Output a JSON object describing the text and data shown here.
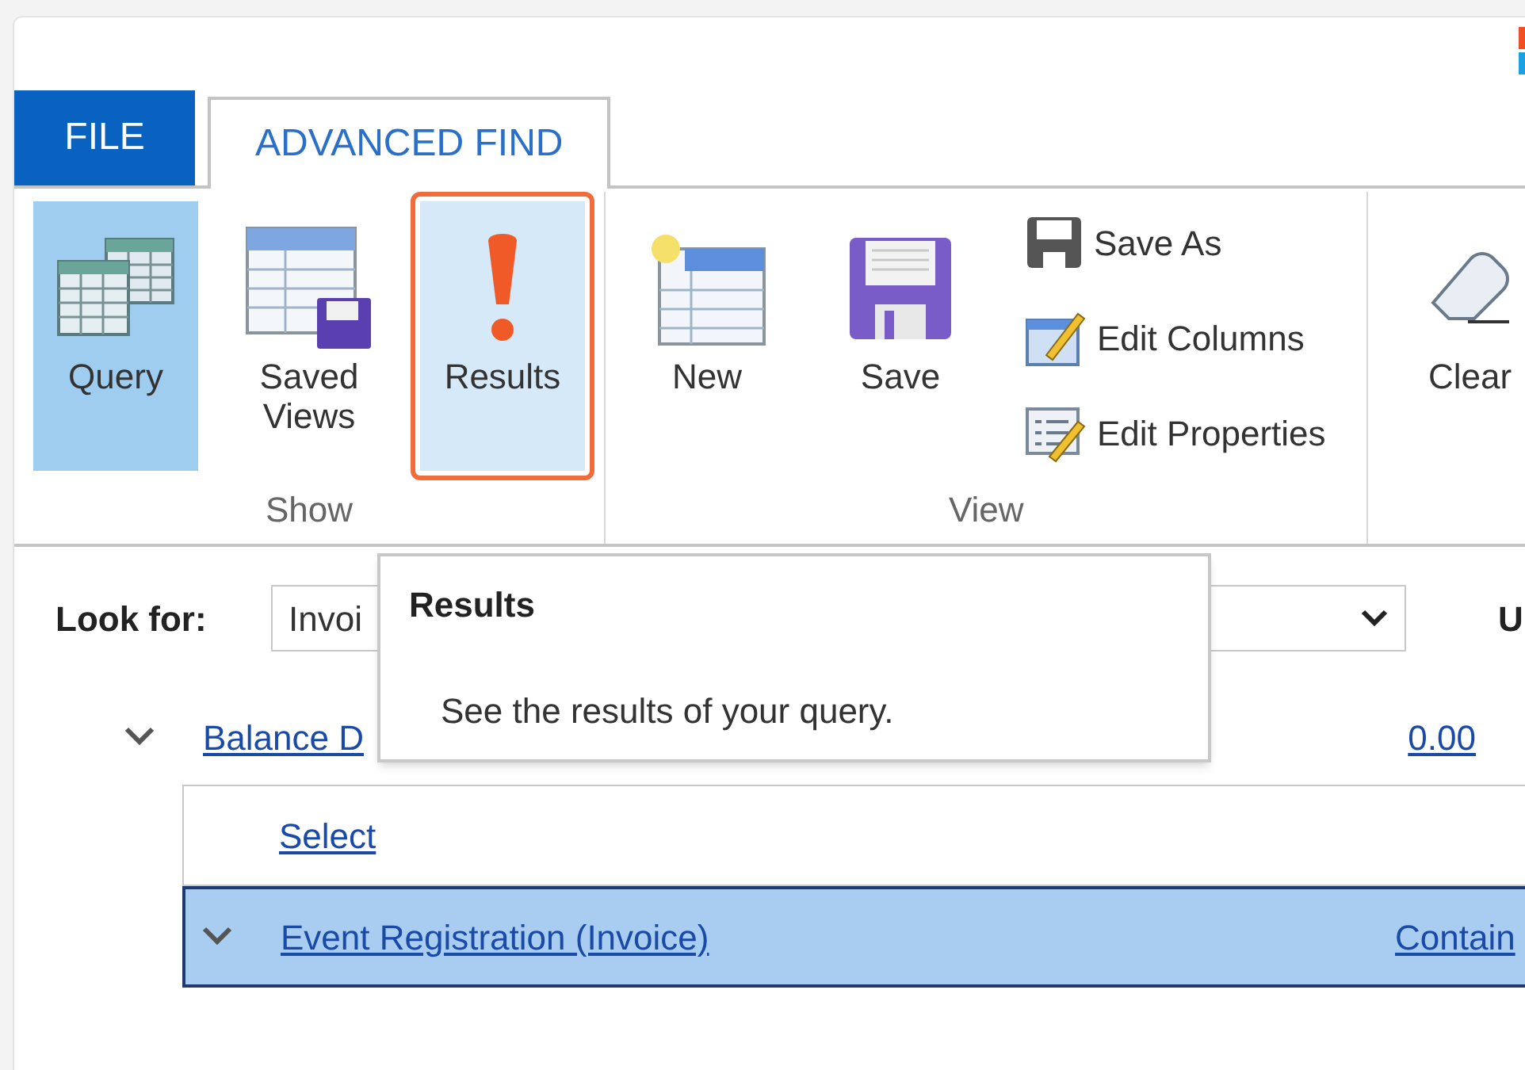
{
  "tabs": [
    {
      "label": "FILE",
      "kind": "file",
      "selected": false
    },
    {
      "label": "ADVANCED FIND",
      "kind": "ribbon",
      "selected": true
    }
  ],
  "ribbon": {
    "groups": [
      {
        "label": "Show",
        "buttons": [
          {
            "label": "Query",
            "kind": "large",
            "selected": true,
            "highlighted": false
          },
          {
            "label": "Saved Views",
            "kind": "large",
            "selected": false,
            "highlighted": false
          },
          {
            "label": "Results",
            "kind": "large",
            "selected": false,
            "highlighted": true
          }
        ]
      },
      {
        "label": "View",
        "buttons": [
          {
            "label": "New",
            "kind": "large",
            "selected": false,
            "highlighted": false
          },
          {
            "label": "Save",
            "kind": "large",
            "selected": false,
            "highlighted": false
          },
          {
            "label": "Save As",
            "kind": "small",
            "selected": false,
            "highlighted": false
          },
          {
            "label": "Edit Columns",
            "kind": "small",
            "selected": false,
            "highlighted": false
          },
          {
            "label": "Edit Properties",
            "kind": "small",
            "selected": false,
            "highlighted": false
          }
        ]
      },
      {
        "buttons": [
          {
            "label": "Clear",
            "kind": "large",
            "selected": false,
            "highlighted": false
          }
        ]
      }
    ]
  },
  "query": {
    "look_for_label": "Look for:",
    "look_for_value": "Invoi",
    "label_2": "U",
    "rows": [
      {
        "kind": "condition",
        "field": "Balance D",
        "value": "0.00",
        "selected": false
      },
      {
        "kind": "select",
        "field": "Select",
        "selected": false
      },
      {
        "kind": "related",
        "field": "Event Registration (Invoice)",
        "value": "Contain",
        "selected": true
      }
    ]
  },
  "tooltip": {
    "title": "Results",
    "text": "See the results of your query."
  }
}
